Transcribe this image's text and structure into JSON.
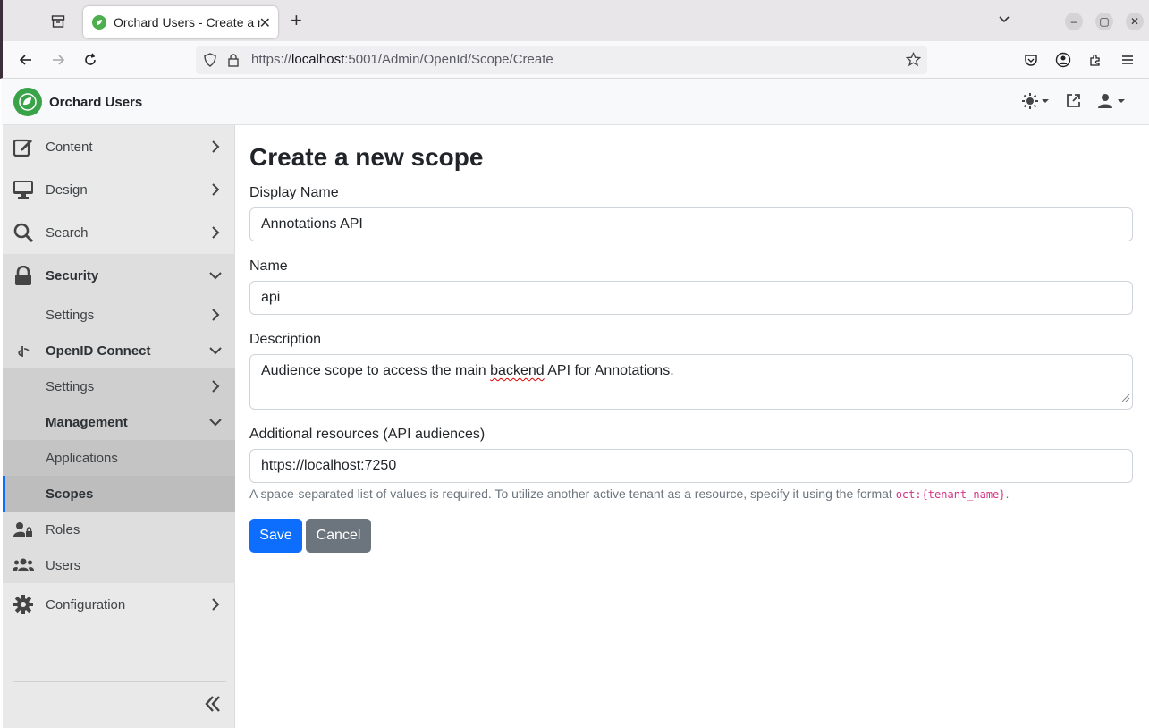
{
  "browser": {
    "tab_title": "Orchard Users - Create a new scope",
    "url_scheme": "https://",
    "url_host": "localhost",
    "url_rest": ":5001/Admin/OpenId/Scope/Create"
  },
  "app": {
    "brand": "Orchard Users"
  },
  "sidebar": {
    "content": "Content",
    "design": "Design",
    "search": "Search",
    "security": "Security",
    "security_settings": "Settings",
    "openid": "OpenID Connect",
    "openid_settings": "Settings",
    "management": "Management",
    "applications": "Applications",
    "scopes": "Scopes",
    "roles": "Roles",
    "users": "Users",
    "configuration": "Configuration"
  },
  "form": {
    "title": "Create a new scope",
    "display_name_label": "Display Name",
    "display_name_value": "Annotations API",
    "name_label": "Name",
    "name_value": "api",
    "description_label": "Description",
    "description_pre": "Audience scope to access the main ",
    "description_misspelled": "backend",
    "description_post": " API for Annotations.",
    "resources_label": "Additional resources (API audiences)",
    "resources_value": "https://localhost:7250",
    "help_text": "A space-separated list of values is required. To utilize another active tenant as a resource, specify it using the format",
    "help_code": "oct:{tenant_name}",
    "help_end": ".",
    "save": "Save",
    "cancel": "Cancel"
  },
  "colors": {
    "primary": "#0d6efd",
    "secondary": "#6c757d",
    "brand_green": "#3aa34a"
  }
}
